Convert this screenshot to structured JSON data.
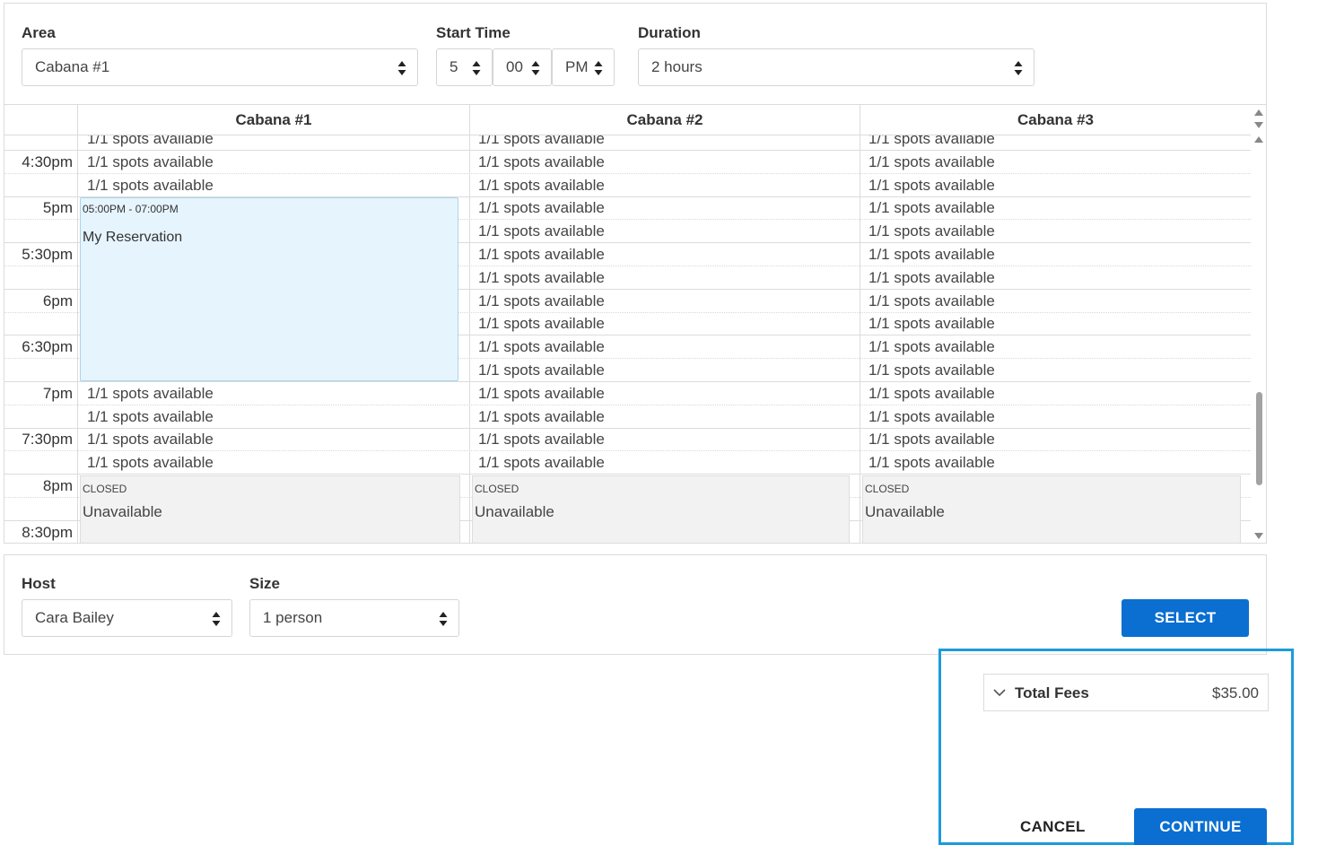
{
  "filters": {
    "area_label": "Area",
    "area_value": "Cabana #1",
    "start_time_label": "Start Time",
    "hour_value": "5",
    "minute_value": "00",
    "ampm_value": "PM",
    "duration_label": "Duration",
    "duration_value": "2 hours"
  },
  "grid": {
    "columns": [
      "Cabana #1",
      "Cabana #2",
      "Cabana #3"
    ],
    "partial_top_text": "1/1 spots available",
    "time_labels": [
      "4:30pm",
      "5pm",
      "5:30pm",
      "6pm",
      "6:30pm",
      "7pm",
      "7:30pm",
      "8pm",
      "8:30pm"
    ],
    "slot_text": "1/1 spots available",
    "reservation": {
      "time": "05:00PM - 07:00PM",
      "title": "My Reservation"
    },
    "closed": {
      "status": "CLOSED",
      "text": "Unavailable"
    }
  },
  "booking": {
    "host_label": "Host",
    "host_value": "Cara Bailey",
    "size_label": "Size",
    "size_value": "1 person",
    "select_label": "SELECT"
  },
  "fees": {
    "label": "Total Fees",
    "amount": "$35.00",
    "cancel_label": "CANCEL",
    "continue_label": "CONTINUE"
  },
  "colors": {
    "primary": "#0a6fd0",
    "reservation_bg": "#e6f4fd",
    "highlight_frame": "#1c9bdc",
    "closed_bg": "#f2f2f2"
  }
}
